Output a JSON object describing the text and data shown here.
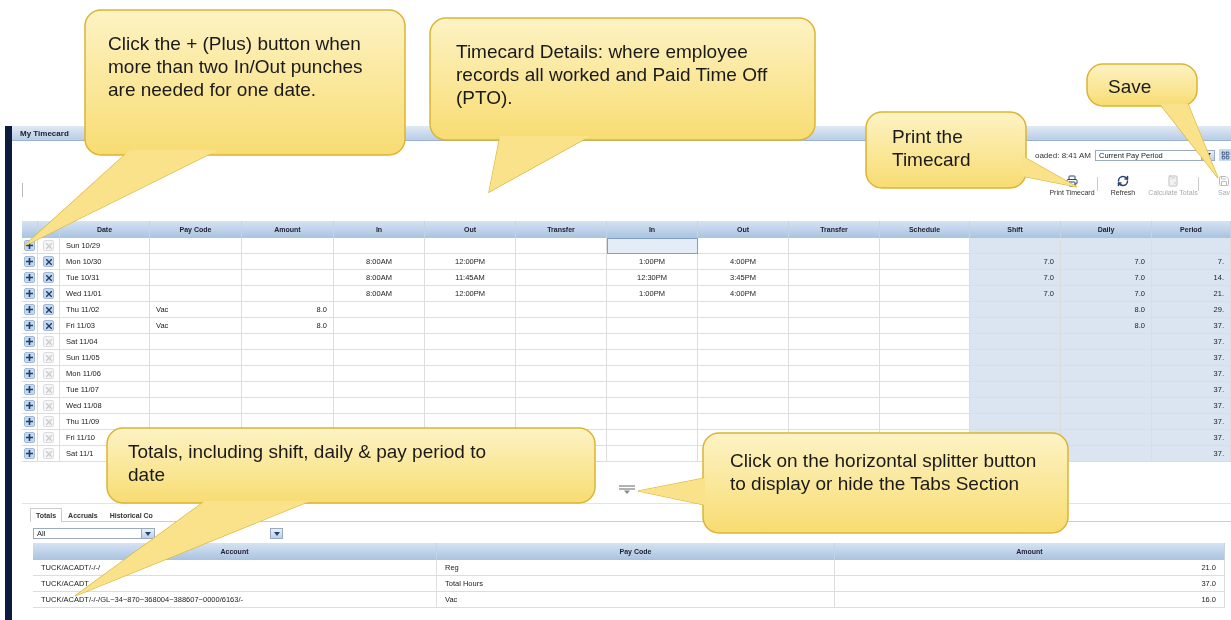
{
  "window": {
    "title": "My Timecard"
  },
  "header": {
    "loaded": "oaded: 8:41 AM",
    "period_select": "Current Pay Period"
  },
  "toolbar": [
    {
      "kind": "print",
      "label": "Print Timecard",
      "disabled": false
    },
    {
      "kind": "refresh",
      "label": "Refresh",
      "disabled": false
    },
    {
      "kind": "calculate",
      "label": "Calculate Totals",
      "disabled": true
    },
    {
      "kind": "save",
      "label": "Sav",
      "disabled": true
    }
  ],
  "timecard": {
    "columns": [
      {
        "label": "Date",
        "shaded": false
      },
      {
        "label": "Pay Code",
        "shaded": false
      },
      {
        "label": "Amount",
        "shaded": false
      },
      {
        "label": "In",
        "shaded": false
      },
      {
        "label": "Out",
        "shaded": false
      },
      {
        "label": "Transfer",
        "shaded": false
      },
      {
        "label": "In",
        "shaded": false
      },
      {
        "label": "Out",
        "shaded": false
      },
      {
        "label": "Transfer",
        "shaded": false
      },
      {
        "label": "Schedule",
        "shaded": false
      },
      {
        "label": "Shift",
        "shaded": true
      },
      {
        "label": "Daily",
        "shaded": true
      },
      {
        "label": "Period",
        "shaded": true
      }
    ],
    "rows": [
      {
        "date": "Sun 10/29",
        "delete_enabled": false,
        "in2_focused": true
      },
      {
        "date": "Mon 10/30",
        "delete_enabled": true,
        "in2_focused": false,
        "in_1": "8:00AM",
        "out_1": "12:00PM",
        "in_2": "1:00PM",
        "out_2": "4:00PM",
        "shift": "7.0",
        "daily": "7.0",
        "period": "7."
      },
      {
        "date": "Tue 10/31",
        "delete_enabled": true,
        "in2_focused": false,
        "in_1": "8:00AM",
        "out_1": "11:45AM",
        "in_2": "12:30PM",
        "out_2": "3:45PM",
        "shift": "7.0",
        "daily": "7.0",
        "period": "14."
      },
      {
        "date": "Wed 11/01",
        "delete_enabled": true,
        "in2_focused": false,
        "in_1": "8:00AM",
        "out_1": "12:00PM",
        "in_2": "1:00PM",
        "out_2": "4:00PM",
        "shift": "7.0",
        "daily": "7.0",
        "period": "21."
      },
      {
        "date": "Thu 11/02",
        "delete_enabled": true,
        "in2_focused": false,
        "pay_code": "Vac",
        "amount": "8.0",
        "daily": "8.0",
        "period": "29."
      },
      {
        "date": "Fri 11/03",
        "delete_enabled": true,
        "in2_focused": false,
        "pay_code": "Vac",
        "amount": "8.0",
        "daily": "8.0",
        "period": "37."
      },
      {
        "date": "Sat 11/04",
        "delete_enabled": false,
        "in2_focused": false,
        "period": "37."
      },
      {
        "date": "Sun 11/05",
        "delete_enabled": false,
        "in2_focused": false,
        "period": "37."
      },
      {
        "date": "Mon 11/06",
        "delete_enabled": false,
        "in2_focused": false,
        "period": "37."
      },
      {
        "date": "Tue 11/07",
        "delete_enabled": false,
        "in2_focused": false,
        "period": "37."
      },
      {
        "date": "Wed 11/08",
        "delete_enabled": false,
        "in2_focused": false,
        "period": "37."
      },
      {
        "date": "Thu 11/09",
        "delete_enabled": false,
        "in2_focused": false,
        "period": "37."
      },
      {
        "date": "Fri 11/10",
        "delete_enabled": false,
        "in2_focused": false,
        "period": "37."
      },
      {
        "date": "Sat 11/1",
        "delete_enabled": false,
        "in2_focused": false,
        "period": "37."
      }
    ]
  },
  "tabs": [
    {
      "label": "Totals",
      "selected": true
    },
    {
      "label": "Accruals",
      "selected": false
    },
    {
      "label": "Historical Co",
      "selected": false
    }
  ],
  "filters": [
    {
      "kind": "select",
      "value": "All"
    },
    {
      "kind": "dropdown"
    }
  ],
  "totals": {
    "columns": [
      "Account",
      "Pay Code",
      "Amount"
    ],
    "rows": [
      {
        "account": "TUCK/ACADT/-/-/",
        "pay_code": "Reg",
        "amount": "21.0"
      },
      {
        "account": "TUCK/ACADT",
        "pay_code": "Total Hours",
        "amount": "37.0"
      },
      {
        "account": "TUCK/ACADT/-/-/GL~34~870~368004~388607~0000/6163/-",
        "pay_code": "Vac",
        "amount": "16.0"
      }
    ]
  },
  "callouts": [
    "Click the + (Plus) button when more than two In/Out punches are needed for one date.",
    "Timecard Details: where employee records all worked and Paid Time Off (PTO).",
    "Print the Timecard",
    "Save",
    "Totals, including shift, daily & pay period to date",
    "Click on the horizontal splitter button to display or hide the Tabs Section"
  ]
}
